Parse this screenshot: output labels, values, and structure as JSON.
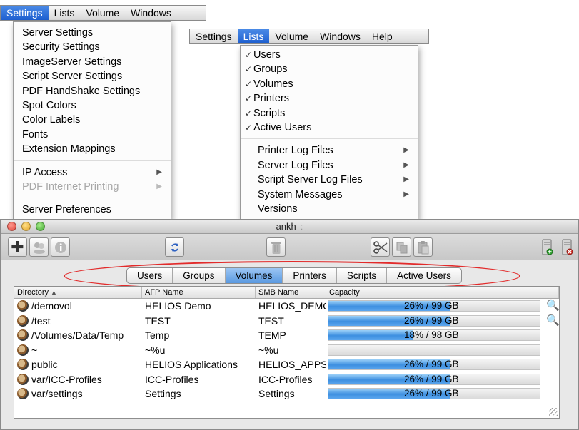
{
  "menubar_settings": {
    "items": [
      "Settings",
      "Lists",
      "Volume",
      "Windows"
    ]
  },
  "settings_menu": {
    "items": [
      {
        "label": "Server Settings"
      },
      {
        "label": "Security Settings"
      },
      {
        "label": "ImageServer Settings"
      },
      {
        "label": "Script Server Settings"
      },
      {
        "label": "PDF HandShake Settings"
      },
      {
        "label": "Spot Colors"
      },
      {
        "label": "Color Labels"
      },
      {
        "label": "Fonts"
      },
      {
        "label": "Extension Mappings"
      },
      {
        "label": "IP Access"
      },
      {
        "label": "PDF Internet Printing"
      },
      {
        "label": "Server Preferences"
      }
    ]
  },
  "menubar_lists": {
    "items": [
      "Settings",
      "Lists",
      "Volume",
      "Windows",
      "Help"
    ]
  },
  "lists_menu": {
    "checked_items": [
      "Users",
      "Groups",
      "Volumes",
      "Printers",
      "Scripts",
      "Active Users"
    ],
    "submenu_items": [
      "Printer Log Files",
      "Server Log Files",
      "Script Server Log Files",
      "System Messages"
    ],
    "last_item": "Versions"
  },
  "window": {
    "title": "ankh",
    "title_suffix": ":"
  },
  "tabs": [
    "Users",
    "Groups",
    "Volumes",
    "Printers",
    "Scripts",
    "Active Users"
  ],
  "selected_tab": "Volumes",
  "table": {
    "headers": [
      "Directory",
      "AFP Name",
      "SMB Name",
      "Capacity"
    ],
    "rows": [
      {
        "directory": "/demovol",
        "afp": "HELIOS Demo",
        "smb": "HELIOS_DEMO",
        "capacity_pct": 26,
        "capacity_text": "26%  /  99 GB",
        "search": true
      },
      {
        "directory": "/test",
        "afp": "TEST",
        "smb": "TEST",
        "capacity_pct": 26,
        "capacity_text": "26%  /  99 GB",
        "search": true
      },
      {
        "directory": "/Volumes/Data/Temp",
        "afp": "Temp",
        "smb": "TEMP",
        "capacity_pct": 18,
        "capacity_text": "18%  /  98 GB",
        "search": false
      },
      {
        "directory": "~",
        "afp": "~%u",
        "smb": "~%u",
        "capacity_pct": 0,
        "capacity_text": "",
        "search": false
      },
      {
        "directory": "public",
        "afp": "HELIOS Applications",
        "smb": "HELIOS_APPS",
        "capacity_pct": 26,
        "capacity_text": "26%  /  99 GB",
        "search": false
      },
      {
        "directory": "var/ICC-Profiles",
        "afp": "ICC-Profiles",
        "smb": "ICC-Profiles",
        "capacity_pct": 26,
        "capacity_text": "26%  /  99 GB",
        "search": false
      },
      {
        "directory": "var/settings",
        "afp": "Settings",
        "smb": "Settings",
        "capacity_pct": 26,
        "capacity_text": "26%  /  99 GB",
        "search": false
      }
    ]
  },
  "colors": {
    "highlight": "#2f6fd8",
    "annotation": "#e22b2b",
    "capacity_fill": "#3d8fe0"
  },
  "icons": {
    "add": "plus-icon",
    "refresh": "refresh-icon",
    "trash": "trash-icon",
    "cut": "scissors-icon",
    "copy": "copy-icon",
    "paste": "paste-icon",
    "server_add": "server-add-icon",
    "server_remove": "server-remove-icon",
    "search": "magnifier-icon"
  }
}
